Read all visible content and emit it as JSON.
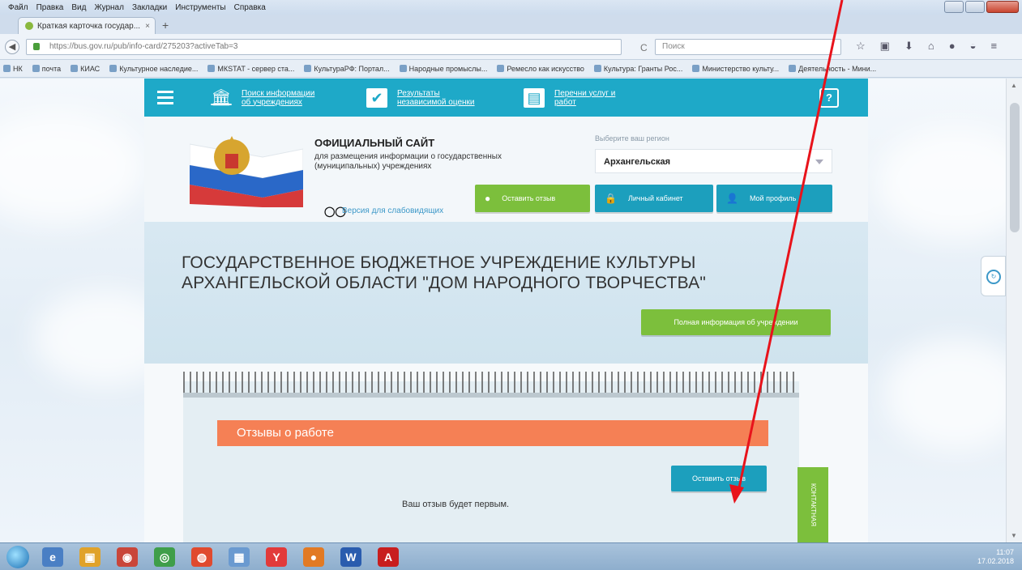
{
  "browser": {
    "menu": [
      "Файл",
      "Правка",
      "Вид",
      "Журнал",
      "Закладки",
      "Инструменты",
      "Справка"
    ],
    "tab_title": "Краткая карточка государ...",
    "url": "https://bus.gov.ru/pub/info-card/275203?activeTab=3",
    "search_placeholder": "Поиск",
    "bookmarks": [
      "НК",
      "почта",
      "КИАС",
      "Культурное наследие...",
      "МКSTAT - сервер ста...",
      "КультураРФ: Портал...",
      "Народные промыслы...",
      "Ремесло как искусство",
      "Культура: Гранты Рос...",
      "Министерство культу...",
      "Деятельность - Мини..."
    ]
  },
  "site": {
    "nav": {
      "item1": "Поиск информации об учреждениях",
      "item2": "Результаты независимой оценки",
      "item3": "Перечни услуг и работ",
      "help_icon": "question-icon"
    },
    "header": {
      "title": "ОФИЦИАЛЬНЫЙ САЙТ",
      "subtitle": "для размещения информации о государственных (муниципальных) учреждениях",
      "low_vision": "Версия для слабовидящих",
      "region_label": "Выберите ваш регион",
      "region_value": "Архангельская",
      "btn_feedback": "Оставить отзыв",
      "btn_cabinet": "Личный кабинет",
      "btn_profile": "Мой профиль"
    },
    "org": {
      "name_line1": "ГОСУДАРСТВЕННОЕ БЮДЖЕТНОЕ УЧРЕЖДЕНИЕ КУЛЬТУРЫ",
      "name_line2": "АРХАНГЕЛЬСКОЙ ОБЛАСТИ \"ДОМ НАРОДНОГО ТВОРЧЕСТВА\"",
      "full_info_btn": "Полная информация об учреждении"
    },
    "reviews": {
      "heading": "Отзывы о работе",
      "leave_btn": "Оставить отзыв",
      "empty_text": "Ваш отзыв будет первым.",
      "side_tab": "КОНТАКТНАЯ ИНФОРМАЦИЯ"
    }
  },
  "taskbar": {
    "time": "11:07",
    "date": "17.02.2018"
  },
  "colors": {
    "nav_teal": "#1ea9c8",
    "green": "#7cbf3c",
    "orange": "#f58055",
    "annotation_red": "#e8131b"
  }
}
